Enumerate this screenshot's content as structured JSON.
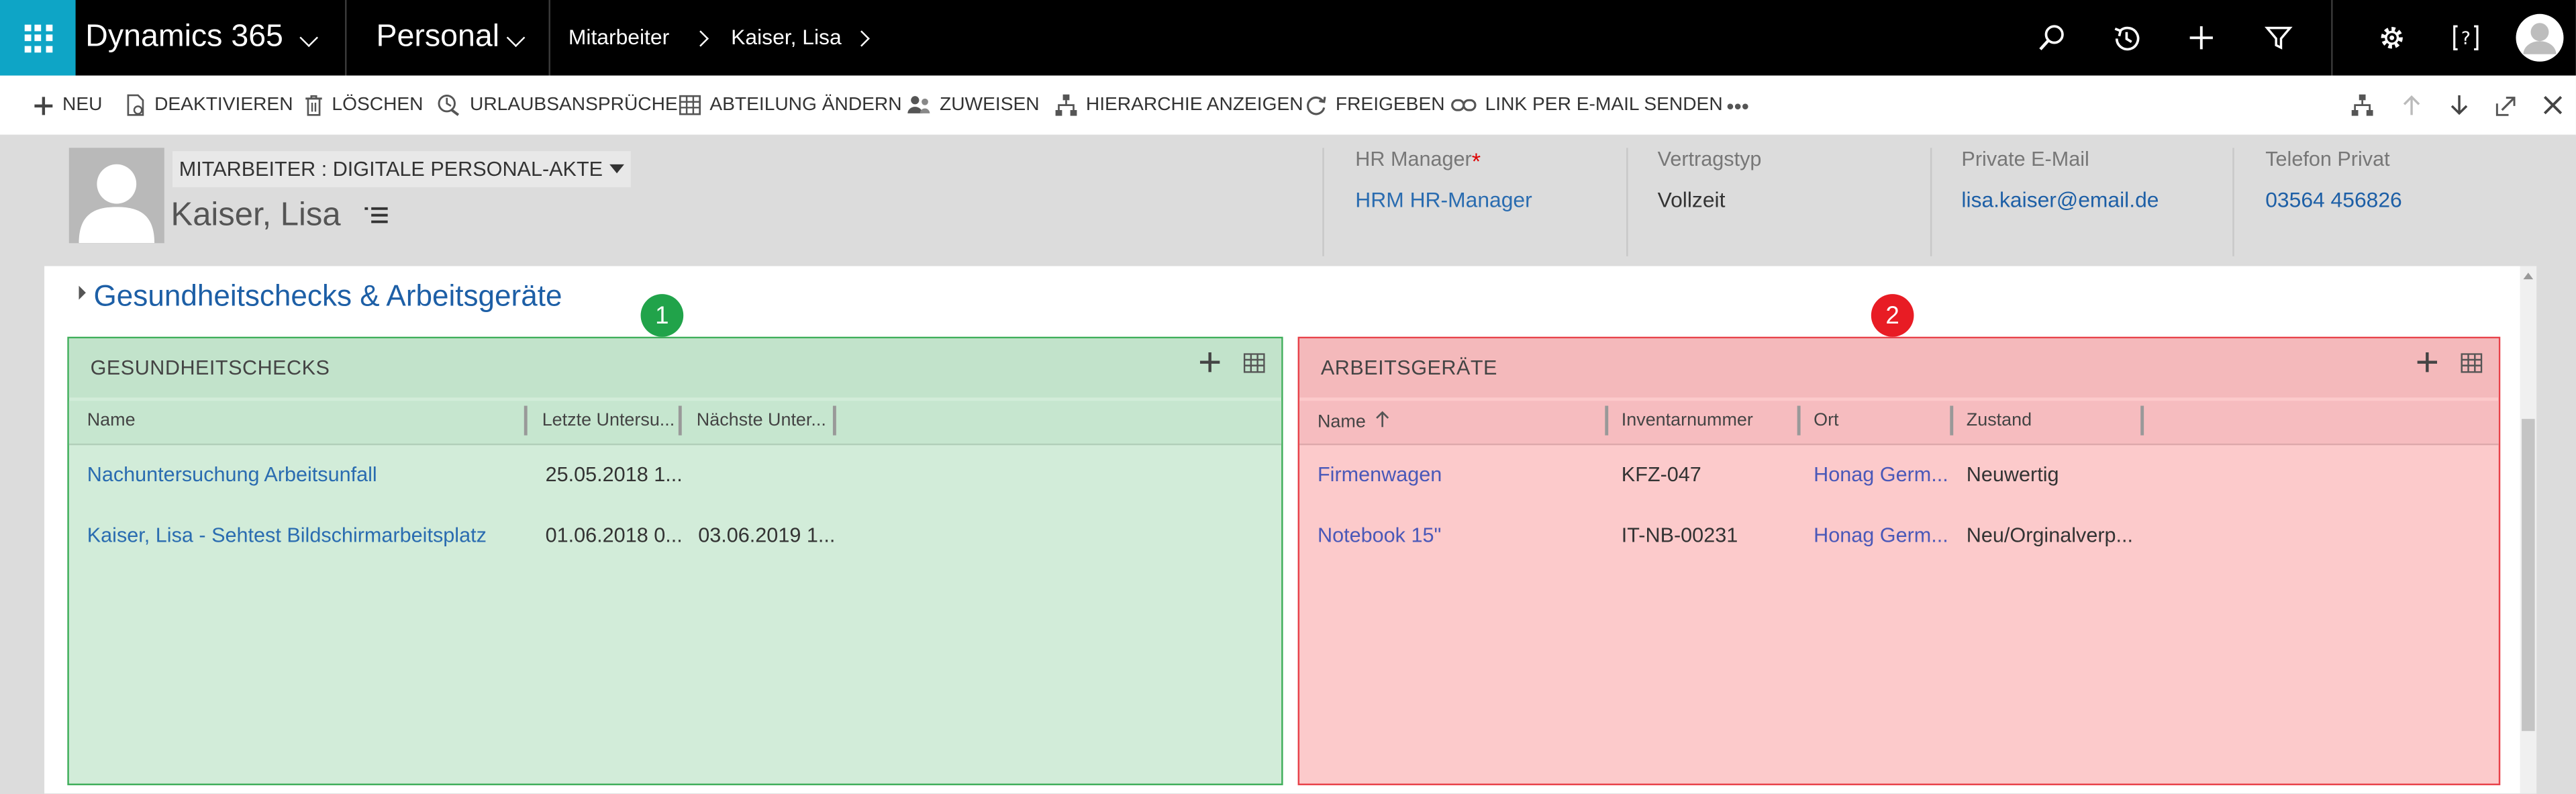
{
  "nav": {
    "app_name": "Dynamics 365",
    "area": "Personal",
    "breadcrumb": [
      "Mitarbeiter",
      "Kaiser, Lisa"
    ]
  },
  "commands": {
    "new": "NEU",
    "deactivate": "DEAKTIVIEREN",
    "delete": "LÖSCHEN",
    "leave": "URLAUBSANSPRÜCHE",
    "department": "ABTEILUNG ÄNDERN",
    "assign": "ZUWEISEN",
    "hierarchy": "HIERARCHIE ANZEIGEN",
    "share": "FREIGEBEN",
    "email_link": "LINK PER E-MAIL SENDEN",
    "more": "•••"
  },
  "record": {
    "form_selector": "MITARBEITER : DIGITALE PERSONAL-AKTE",
    "name": "Kaiser, Lisa",
    "fields": [
      {
        "label": "HR Manager",
        "value": "HRM HR-Manager",
        "required": true
      },
      {
        "label": "Vertragstyp",
        "value": "Vollzeit"
      },
      {
        "label": "Private E-Mail",
        "value": "lisa.kaiser@email.de"
      },
      {
        "label": "Telefon Privat",
        "value": "03564 456826"
      }
    ]
  },
  "section_title": "Gesundheitschecks & Arbeitsgeräte",
  "health": {
    "title": "GESUNDHEITSCHECKS",
    "columns": [
      "Name",
      "Letzte Untersu...",
      "Nächste Unter..."
    ],
    "rows": [
      [
        "Nachuntersuchung Arbeitsunfall",
        "25.05.2018 1...",
        ""
      ],
      [
        "Kaiser, Lisa  - Sehtest Bildschirmarbeitsplatz",
        "01.06.2018 0...",
        "03.06.2019 1..."
      ]
    ]
  },
  "equipment": {
    "title": "ARBEITSGERÄTE",
    "columns": [
      "Name",
      "Inventarnummer",
      "Ort",
      "Zustand"
    ],
    "rows": [
      [
        "Firmenwagen",
        "KFZ-047",
        "Honag Germ...",
        "Neuwertig"
      ],
      [
        "Notebook 15\"",
        "IT-NB-00231",
        "Honag Germ...",
        "Neu/Orginalverp..."
      ]
    ]
  },
  "badges": [
    "1",
    "2"
  ],
  "colors": {
    "accent": "#0ea5c6",
    "link": "#2a6cb0",
    "health_bg": "#d2ecd9",
    "health_border": "#3fae5a",
    "equipment_bg": "#fccacb",
    "equipment_border": "#e8424a",
    "badge1": "#21a34a",
    "badge2": "#e81c24"
  }
}
